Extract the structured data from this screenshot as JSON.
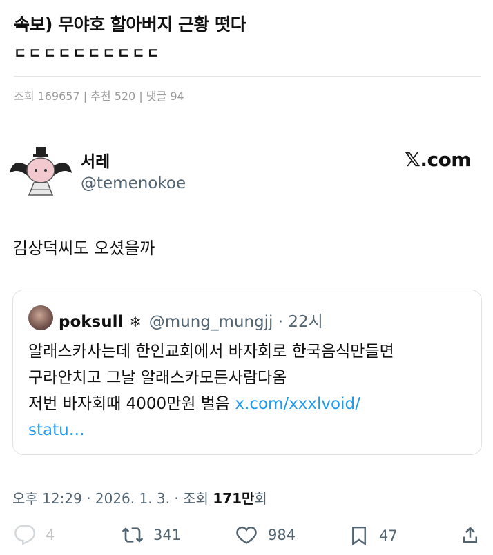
{
  "post": {
    "title": "속보) 무야호 할아버지 근황 떳다",
    "subtitle": "ㄷㄷㄷㄷㄷㄷㄷㄷㄷㄷ",
    "stats": "조회 169657 | 추천 520 | 댓글 94"
  },
  "tweet": {
    "author_name": "서레",
    "author_handle": "@temenokoe",
    "site_label": "𝕏.com",
    "text": "김상덕씨도 오셨을까",
    "quote": {
      "name": "poksull",
      "badge": "❄",
      "handle": "@mung_mungjj",
      "time": "· 22시",
      "line1": "알래스카사는데 한인교회에서 바자회로 한국음식만들면",
      "line2": "구라안치고 그날 알래스카모든사람다옴",
      "line3": "저번 바자회때 4000만원 벌음",
      "link": "x.com/xxxlvoid/",
      "link_cont": "statu…"
    },
    "meta": {
      "time": "오후 12:29 · 2026. 1. 3. · 조회 ",
      "views": "171만",
      "views_suffix": "회"
    },
    "actions": {
      "replies": "4",
      "retweets": "341",
      "likes": "984",
      "bookmarks": "47"
    }
  }
}
